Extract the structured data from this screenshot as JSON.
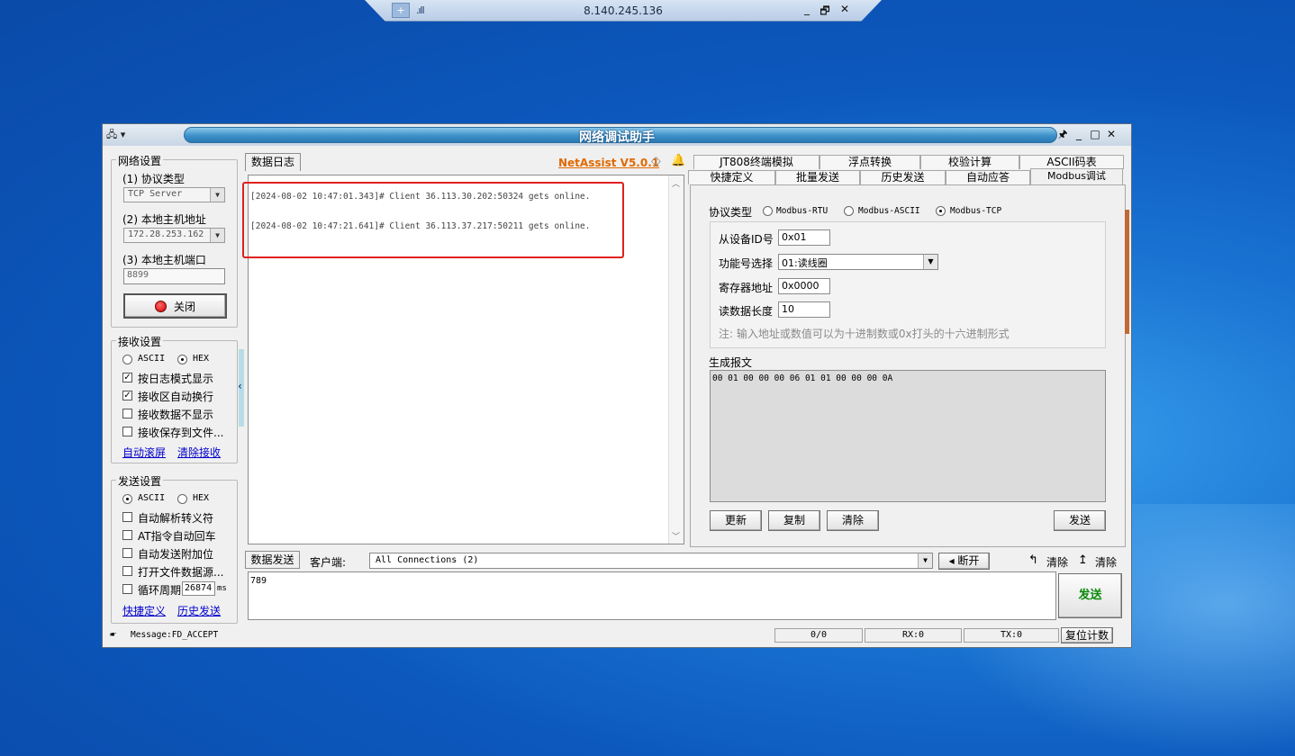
{
  "rdp": {
    "ip": "8.140.245.136",
    "pin": "+",
    "signal": ".ıll",
    "min": "_",
    "restore": "🗗",
    "close": "✕"
  },
  "window": {
    "title": "网络调试助手",
    "sysmenu": "🖧 ▾",
    "pin_icon": "🖈",
    "min": "_",
    "max": "□",
    "close": "✕"
  },
  "net_settings": {
    "legend": "网络设置",
    "protocol_label": "(1) 协议类型",
    "protocol_value": "TCP Server",
    "host_label": "(2) 本地主机地址",
    "host_value": "172.28.253.162",
    "port_label": "(3) 本地主机端口",
    "port_value": "8899",
    "close_button": "关闭"
  },
  "recv_settings": {
    "legend": "接收设置",
    "ascii": "ASCII",
    "hex": "HEX",
    "log_mode": "按日志模式显示",
    "auto_wrap": "接收区自动换行",
    "no_display": "接收数据不显示",
    "save_file": "接收保存到文件...",
    "auto_scroll": "自动滚屏",
    "clear_recv": "清除接收"
  },
  "send_settings": {
    "legend": "发送设置",
    "ascii": "ASCII",
    "hex": "HEX",
    "auto_escape": "自动解析转义符",
    "at_return": "AT指令自动回车",
    "auto_checksum": "自动发送附加位",
    "open_file": "打开文件数据源...",
    "loop_period": "循环周期",
    "loop_value": "26874",
    "loop_unit": "ms",
    "quick_def": "快捷定义",
    "history_send": "历史发送"
  },
  "log": {
    "tab": "数据日志",
    "brand": "NetAssist V5.0.1",
    "lines": [
      "[2024-08-02 10:47:01.343]# Client 36.113.30.202:50324 gets online.",
      "[2024-08-02 10:47:21.641]# Client 36.113.37.217:50211 gets online."
    ],
    "highlight_color": "#e02020"
  },
  "right_tabs": {
    "row1": [
      "JT808终端模拟",
      "浮点转换",
      "校验计算",
      "ASCII码表"
    ],
    "row2": [
      "快捷定义",
      "批量发送",
      "历史发送",
      "自动应答",
      "Modbus调试"
    ]
  },
  "modbus": {
    "protocol_label": "协议类型",
    "rtu": "Modbus-RTU",
    "ascii": "Modbus-ASCII",
    "tcp": "Modbus-TCP",
    "slave_label": "从设备ID号",
    "slave_value": "0x01",
    "func_label": "功能号选择",
    "func_value": "01:读线圈",
    "reg_label": "寄存器地址",
    "reg_value": "0x0000",
    "len_label": "读数据长度",
    "len_value": "10",
    "note": "注: 输入地址或数值可以为十进制数或0x打头的十六进制形式",
    "frame_label": "生成报文",
    "frame_value": "00 01 00 00 00 06 01 01 00 00 00 0A",
    "update": "更新",
    "copy": "复制",
    "clear": "清除",
    "send": "发送"
  },
  "send_bar": {
    "tab": "数据发送",
    "client_label": "客户端:",
    "client_value": "All Connections (2)",
    "disconnect": "断开",
    "clear1": "清除",
    "clear2": "清除",
    "content": "789",
    "send_button": "发送"
  },
  "statusbar": {
    "message": "Message:FD_ACCEPT",
    "count": "0/0",
    "rx": "RX:0",
    "tx": "TX:0",
    "reset": "复位计数"
  }
}
